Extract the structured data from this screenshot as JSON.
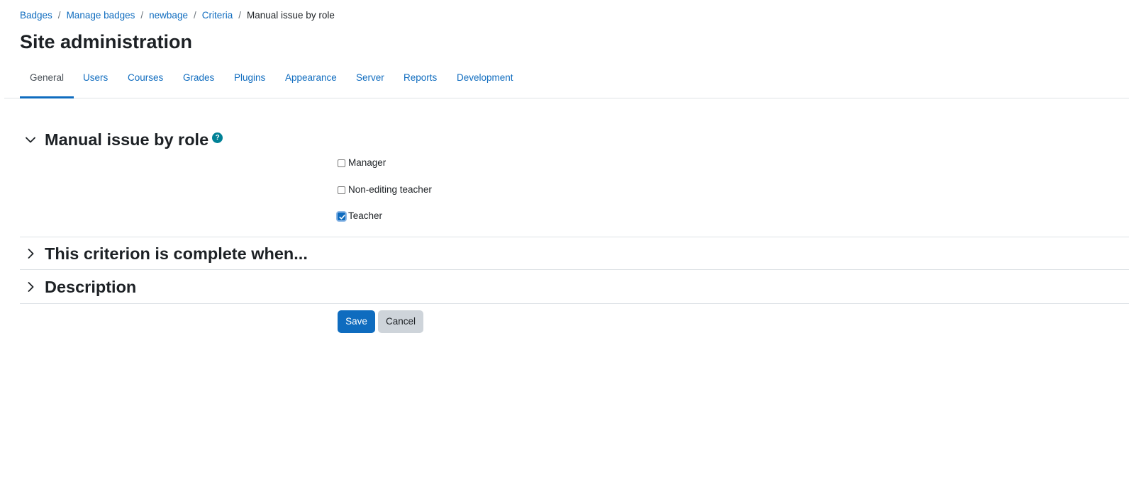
{
  "breadcrumb": {
    "items": [
      "Badges",
      "Manage badges",
      "newbage",
      "Criteria"
    ],
    "current": "Manual issue by role",
    "separator": "/"
  },
  "page_title": "Site administration",
  "tabs": [
    "General",
    "Users",
    "Courses",
    "Grades",
    "Plugins",
    "Appearance",
    "Server",
    "Reports",
    "Development"
  ],
  "active_tab": "General",
  "sections": {
    "manual": {
      "title": "Manual issue by role",
      "expanded": true,
      "help_icon": "?",
      "roles": [
        {
          "label": "Manager",
          "checked": false
        },
        {
          "label": "Non-editing teacher",
          "checked": false
        },
        {
          "label": "Teacher",
          "checked": true
        }
      ]
    },
    "complete": {
      "title": "This criterion is complete when...",
      "expanded": false
    },
    "description": {
      "title": "Description",
      "expanded": false
    }
  },
  "buttons": {
    "save": "Save",
    "cancel": "Cancel"
  },
  "colors": {
    "link": "#0f6cbf",
    "primary": "#0f6cbf",
    "secondary": "#ced4da",
    "help": "#008196"
  }
}
